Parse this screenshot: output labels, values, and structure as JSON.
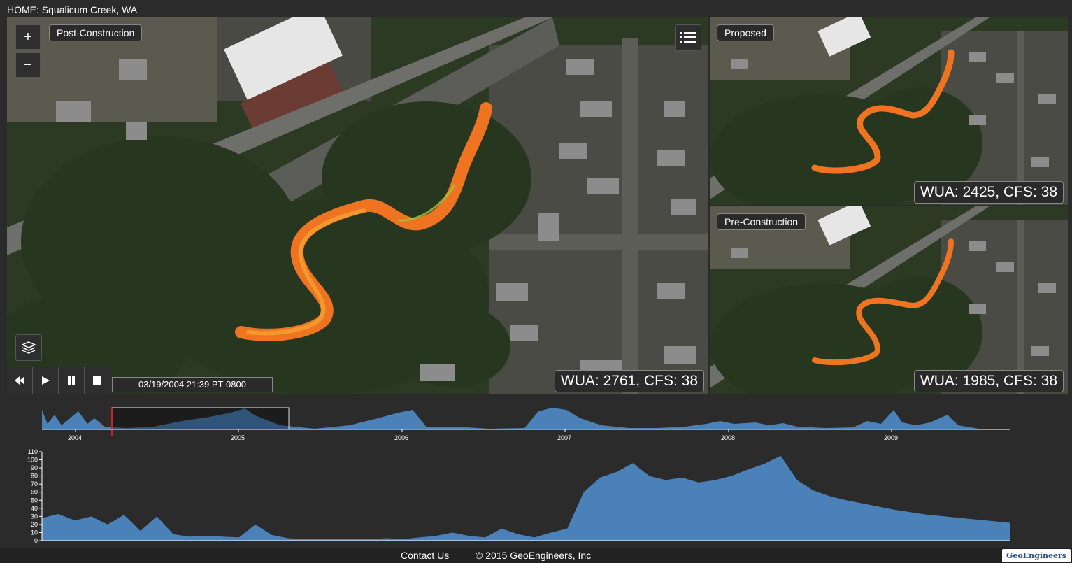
{
  "page": {
    "title": "HOME: Squalicum Creek, WA"
  },
  "maps": {
    "main": {
      "label": "Post-Construction",
      "stat": "WUA: 2761, CFS: 38"
    },
    "proposed": {
      "label": "Proposed",
      "stat": "WUA: 2425, CFS: 38"
    },
    "pre": {
      "label": "Pre-Construction",
      "stat": "WUA: 1985, CFS: 38"
    }
  },
  "controls": {
    "zoom_in": "+",
    "zoom_out": "−",
    "timestamp": "03/19/2004 21:39 PT-0800",
    "icons": [
      "plus-icon",
      "minus-icon",
      "list-icon",
      "layers-icon",
      "rewind-icon",
      "play-icon",
      "pause-icon",
      "stop-icon"
    ]
  },
  "chart_data": [
    {
      "type": "area",
      "title": "",
      "x": [
        "2004",
        "2005",
        "2006",
        "2007",
        "2008",
        "2009"
      ],
      "tick_labels": [
        "2004",
        "2005",
        "2006",
        "2007",
        "2008",
        "2009"
      ],
      "brush_range": [
        "2003-10",
        "2005-04"
      ],
      "current_time": "2004-03-19"
    },
    {
      "type": "area",
      "title": "",
      "ylim": [
        0,
        110
      ],
      "y_ticks": [
        "0",
        "10",
        "20",
        "30",
        "40",
        "50",
        "60",
        "70",
        "80",
        "90",
        "100",
        "110"
      ],
      "values": [
        28,
        33,
        25,
        30,
        20,
        32,
        12,
        30,
        8,
        5,
        6,
        5,
        4,
        20,
        7,
        3,
        2,
        2,
        2,
        2,
        2,
        3,
        2,
        4,
        6,
        10,
        6,
        4,
        15,
        8,
        4,
        10,
        15,
        60,
        78,
        85,
        96,
        80,
        75,
        78,
        72,
        75,
        80,
        88,
        95,
        105,
        75,
        62,
        55,
        50,
        46,
        42,
        38,
        35,
        32,
        30,
        28,
        26,
        24,
        22
      ]
    }
  ],
  "footer": {
    "contact": "Contact Us",
    "copyright": "© 2015 GeoEngineers, Inc",
    "logo": "GeoEngineers"
  },
  "colors": {
    "chart_fill": "#4a81b8",
    "background": "#2b2b2b",
    "plume": "#f07a1a"
  }
}
